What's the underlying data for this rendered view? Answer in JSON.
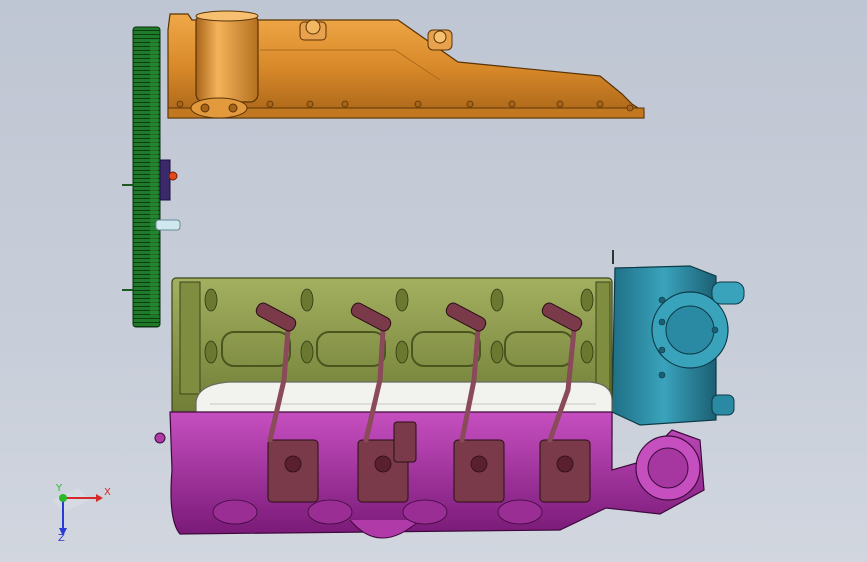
{
  "viewport": {
    "background": "#c6ccd7"
  },
  "colors": {
    "flywheel": "#1f7a2a",
    "oil_pan": "#d98a2a",
    "engine_block": "#8a9a4a",
    "valve_cover_white": "#f2f2ee",
    "coil_packs": "#6a2a3a",
    "intake_manifold": "#b03aa8",
    "front_accessory": "#2f8aa0"
  },
  "parts": [
    {
      "name": "flywheel",
      "icon": "ring-gear"
    },
    {
      "name": "oil-pan",
      "icon": "pan"
    },
    {
      "name": "engine-block",
      "icon": "v8-block"
    },
    {
      "name": "coil-packs",
      "icon": "ignition-coils"
    },
    {
      "name": "intake-manifold",
      "icon": "manifold"
    },
    {
      "name": "front-accessory",
      "icon": "pump-housing"
    }
  ],
  "axis_triad": {
    "x_label": "X",
    "y_label": "Y",
    "z_label": "Z",
    "x_color": "#d62a2a",
    "y_color": "#2ab82a",
    "z_color": "#2a3ad6"
  }
}
